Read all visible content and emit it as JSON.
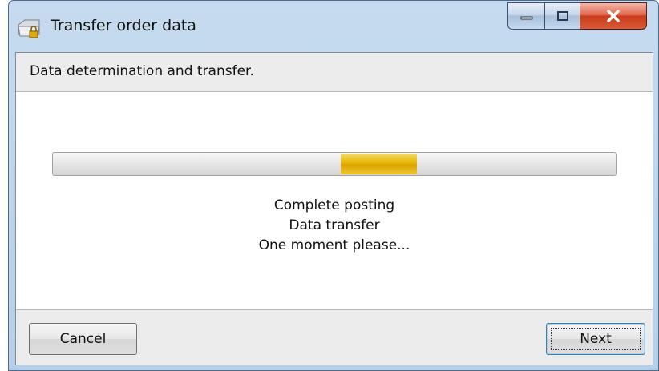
{
  "window": {
    "title": "Transfer order data",
    "icons": {
      "app": "folder-lock-icon",
      "minimize": "minimize-icon",
      "maximize": "maximize-icon",
      "close": "close-icon"
    },
    "colors": {
      "progress": "#e6b500",
      "close_button": "#c83b1c"
    }
  },
  "header": {
    "text": "Data determination and transfer."
  },
  "progress": {
    "indeterminate": true,
    "chunk_start_fraction": 0.512,
    "chunk_width_fraction": 0.135
  },
  "status": {
    "line1": "Complete posting",
    "line2": "Data transfer",
    "line3": "One moment please..."
  },
  "buttons": {
    "cancel": "Cancel",
    "next": "Next"
  }
}
